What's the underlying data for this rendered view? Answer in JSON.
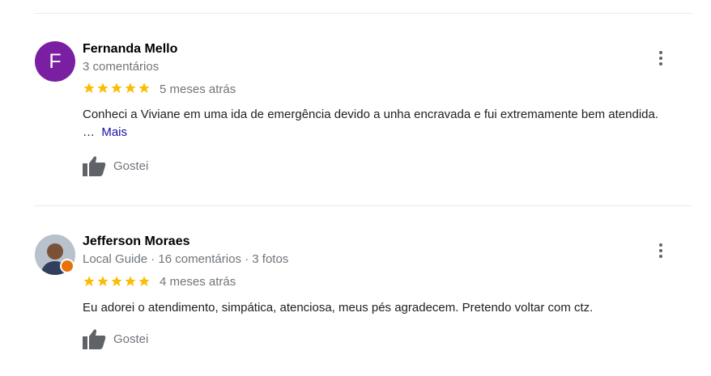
{
  "reviews": [
    {
      "avatar_letter": "F",
      "avatar_color": "#7b1fa2",
      "name": "Fernanda Mello",
      "meta": "3 comentários",
      "rating": 5,
      "date": "5 meses atrás",
      "text": "Conheci a Viviane em uma ida de emergência devido a unha encravada e fui extremamente bem atendida. …",
      "more": "Mais",
      "like": "Gostei"
    },
    {
      "name": "Jefferson Moraes",
      "meta": "Local Guide · 16 comentários · 3 fotos",
      "rating": 5,
      "date": "4 meses atrás",
      "text": "Eu adorei o atendimento, simpática,  atenciosa, meus pés agradecem. Pretendo voltar com ctz.",
      "like": "Gostei"
    }
  ],
  "colors": {
    "star": "#fbbc04",
    "link": "#1a0dab",
    "muted": "#70757a",
    "badge": "#e8710a"
  },
  "icons": {
    "menu": "more-vert-icon",
    "like": "thumb-up-icon",
    "star": "star-icon",
    "badge": "local-guide-badge-icon"
  }
}
